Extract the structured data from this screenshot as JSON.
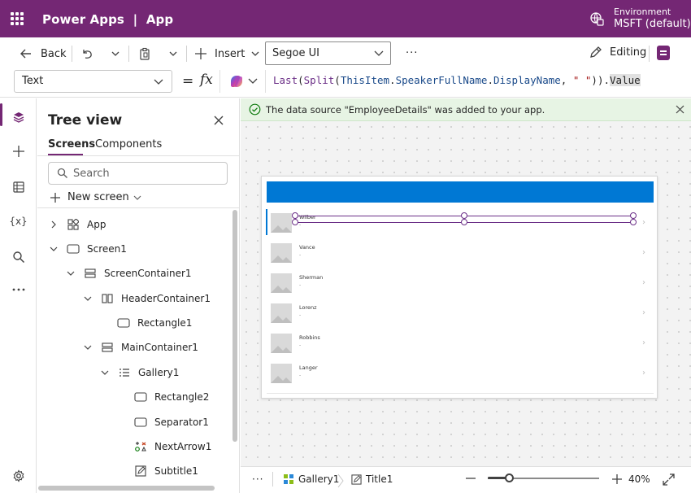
{
  "header": {
    "app_title": "Power Apps  |  App",
    "environment_label": "Environment",
    "environment_value": "MSFT (default)",
    "bg_color": "#742774"
  },
  "commandbar": {
    "back_label": "Back",
    "insert_label": "Insert",
    "font_value": "Segoe UI",
    "more_label": "···",
    "editing_label": "Editing"
  },
  "formula": {
    "property_value": "Text",
    "equals": "=",
    "fx": "fx",
    "tokens": {
      "fn1": "Last",
      "p1": "(",
      "fn2": "Split",
      "p2": "(",
      "id1": "ThisItem",
      "dot1": ".",
      "id2": "SpeakerFullName",
      "dot2": ".",
      "id3": "DisplayName",
      "comma": ", ",
      "str": "\" \"",
      "p3": "))",
      "dot3": ".",
      "prop": "Value"
    }
  },
  "tree": {
    "title": "Tree view",
    "tab_screens": "Screens",
    "tab_components": "Components",
    "search_placeholder": "Search",
    "new_screen_label": "New screen",
    "nodes": [
      {
        "label": "App"
      },
      {
        "label": "Screen1"
      },
      {
        "label": "ScreenContainer1"
      },
      {
        "label": "HeaderContainer1"
      },
      {
        "label": "Rectangle1"
      },
      {
        "label": "MainContainer1"
      },
      {
        "label": "Gallery1"
      },
      {
        "label": "Rectangle2"
      },
      {
        "label": "Separator1"
      },
      {
        "label": "NextArrow1"
      },
      {
        "label": "Subtitle1"
      }
    ]
  },
  "notice": {
    "text": "The data source \"EmployeeDetails\" was added to your app.",
    "color": "#e7f4e4"
  },
  "canvas": {
    "header_color": "#0078d4",
    "items": [
      {
        "name": "Wilber",
        "sub": "-"
      },
      {
        "name": "Vance",
        "sub": "-"
      },
      {
        "name": "Sherman",
        "sub": "-"
      },
      {
        "name": "Lorenz",
        "sub": "-"
      },
      {
        "name": "Robbins",
        "sub": "-"
      },
      {
        "name": "Langer",
        "sub": "-"
      }
    ]
  },
  "statusbar": {
    "more_label": "···",
    "crumb_gallery": "Gallery1",
    "crumb_title": "Title1",
    "zoom_label": "40%",
    "zoom_level": 0.19
  }
}
